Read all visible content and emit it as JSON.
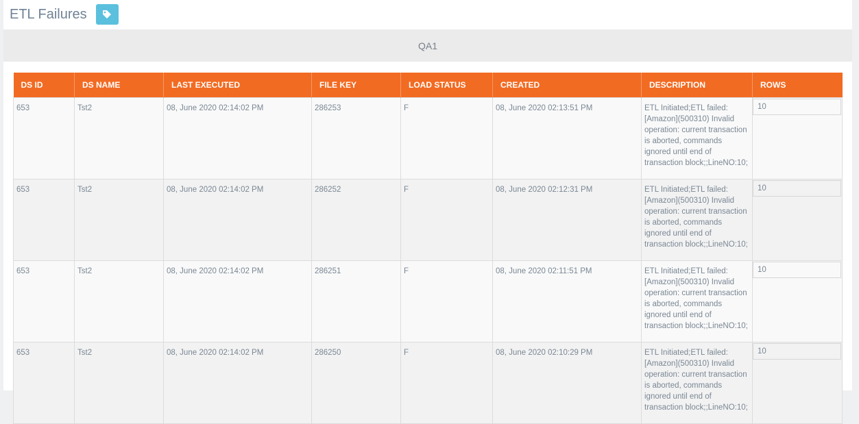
{
  "page": {
    "title": "ETL Failures",
    "tag_icon": "tag-icon",
    "environment": "QA1"
  },
  "colors": {
    "header_bg": "#f26b23",
    "tag_button_bg": "#5bc0de"
  },
  "table": {
    "columns": [
      "DS ID",
      "DS NAME",
      "LAST EXECUTED",
      "FILE KEY",
      "LOAD STATUS",
      "CREATED",
      "DESCRIPTION",
      "ROWS"
    ],
    "rows": [
      {
        "ds_id": "653",
        "ds_name": "Tst2",
        "last_executed": "08, June 2020 02:14:02 PM",
        "file_key": "286253",
        "load_status": "F",
        "created": "08, June 2020 02:13:51 PM",
        "description": "ETL Initiated;ETL failed: [Amazon](500310) Invalid operation: current transaction is aborted, commands ignored until end of transaction block;;LineNO:10;",
        "rows": "10"
      },
      {
        "ds_id": "653",
        "ds_name": "Tst2",
        "last_executed": "08, June 2020 02:14:02 PM",
        "file_key": "286252",
        "load_status": "F",
        "created": "08, June 2020 02:12:31 PM",
        "description": "ETL Initiated;ETL failed: [Amazon](500310) Invalid operation: current transaction is aborted, commands ignored until end of transaction block;;LineNO:10;",
        "rows": "10"
      },
      {
        "ds_id": "653",
        "ds_name": "Tst2",
        "last_executed": "08, June 2020 02:14:02 PM",
        "file_key": "286251",
        "load_status": "F",
        "created": "08, June 2020 02:11:51 PM",
        "description": "ETL Initiated;ETL failed: [Amazon](500310) Invalid operation: current transaction is aborted, commands ignored until end of transaction block;;LineNO:10;",
        "rows": "10"
      },
      {
        "ds_id": "653",
        "ds_name": "Tst2",
        "last_executed": "08, June 2020 02:14:02 PM",
        "file_key": "286250",
        "load_status": "F",
        "created": "08, June 2020 02:10:29 PM",
        "description": "ETL Initiated;ETL failed: [Amazon](500310) Invalid operation: current transaction is aborted, commands ignored until end of transaction block;;LineNO:10;",
        "rows": "10"
      }
    ]
  }
}
